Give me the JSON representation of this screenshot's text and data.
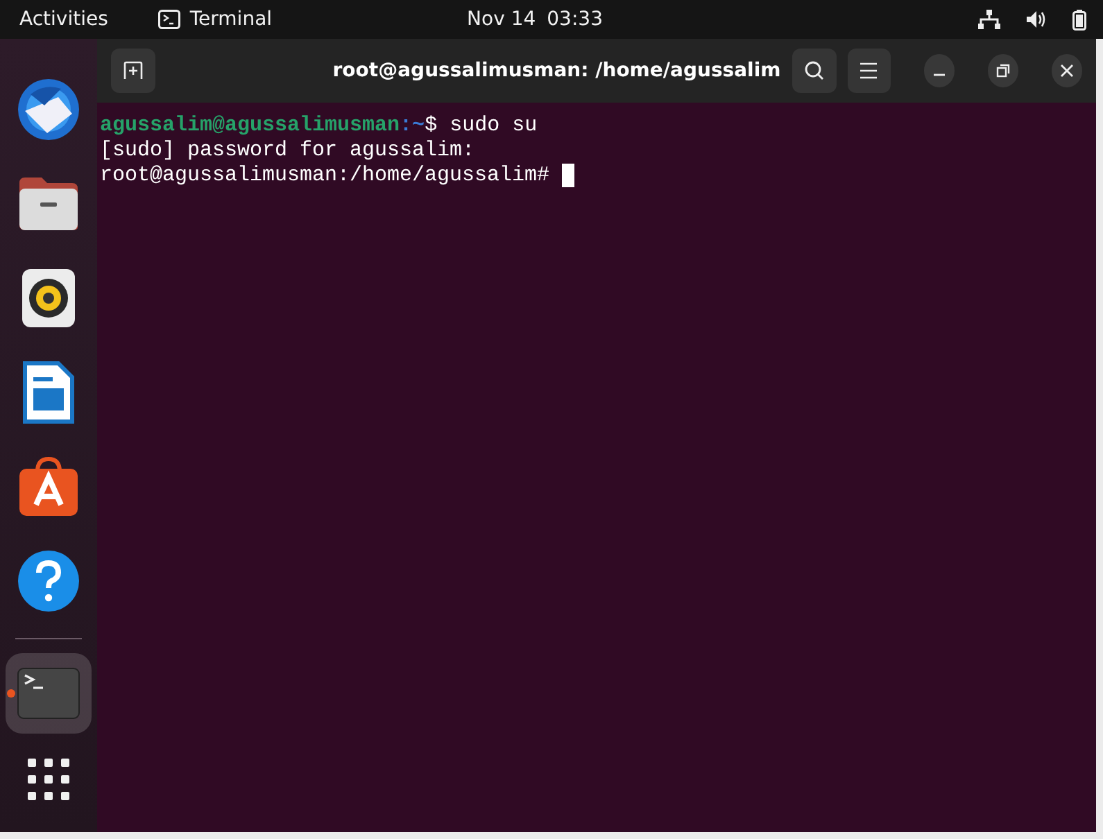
{
  "top_bar": {
    "activities": "Activities",
    "app_name": "Terminal",
    "date": "Nov 14",
    "time": "03:33"
  },
  "dock": [
    {
      "kind": "mail",
      "running": false
    },
    {
      "kind": "files",
      "running": false
    },
    {
      "kind": "music",
      "running": false
    },
    {
      "kind": "writer",
      "running": false
    },
    {
      "kind": "store",
      "running": false
    },
    {
      "kind": "help",
      "running": false
    },
    {
      "kind": "terminal",
      "running": true
    }
  ],
  "window": {
    "title": "root@agussalimusman: /home/agussalim"
  },
  "terminal_lines": [
    {
      "kind": "user_prompt",
      "user_host": "agussalim@agussalimusman",
      "path": ":~",
      "prompt": "$",
      "command": "sudo su"
    },
    {
      "kind": "output",
      "text": "[sudo] password for agussalim:"
    },
    {
      "kind": "root_prompt",
      "text": "root@agussalimusman:/home/agussalim#",
      "cursor": true
    }
  ]
}
